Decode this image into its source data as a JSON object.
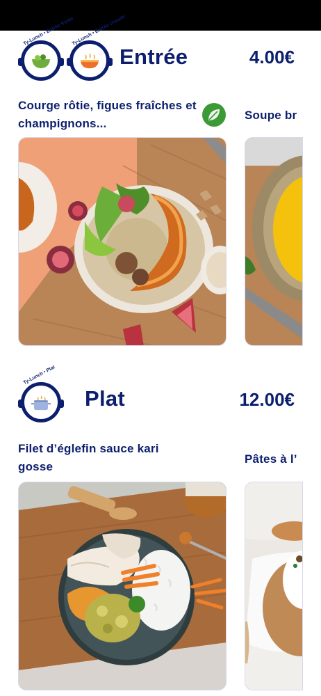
{
  "sections": [
    {
      "id": "entree",
      "title": "Entrée",
      "price": "4.00€",
      "logo_tags": [
        "Ty-Lunch • Entrée froide",
        "Ty-Lunch • Entrée chaude"
      ],
      "items": [
        {
          "title": "Courge rôtie, figues fraîches et champignons...",
          "veg": true,
          "image": "roasted-squash-bowl"
        },
        {
          "title": "Soupe br",
          "image": "yellow-soup"
        }
      ]
    },
    {
      "id": "plat",
      "title": "Plat",
      "price": "12.00€",
      "logo_tags": [
        "Ty-Lunch • Plat"
      ],
      "items": [
        {
          "title": "Filet d’églefin sauce kari gosse",
          "image": "haddock-plate"
        },
        {
          "title": "Pâtes à l’",
          "image": "pasta-bowl"
        }
      ]
    }
  ],
  "colors": {
    "brand": "#0c1f6e",
    "veg_badge": "#3c9a36"
  },
  "icons": {
    "veg": "leaf-icon",
    "entree_cold": "salad-bowl-icon",
    "entree_hot": "soup-bowl-icon",
    "plat": "cooking-pot-icon"
  }
}
